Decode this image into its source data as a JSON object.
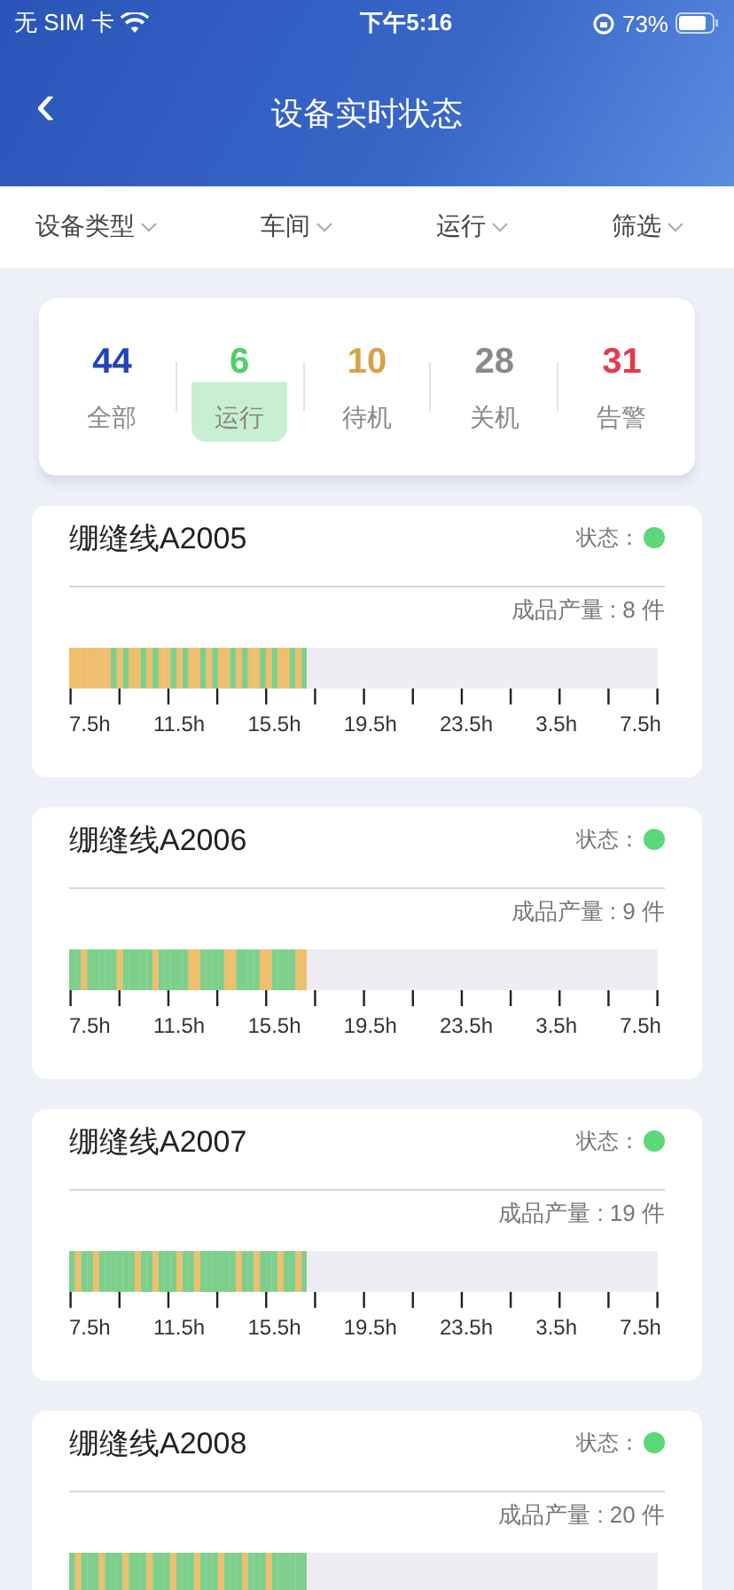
{
  "status_bar": {
    "carrier": "无 SIM 卡",
    "time": "下午5:16",
    "battery": "73%"
  },
  "header": {
    "back": "‹",
    "title": "设备实时状态"
  },
  "filters": [
    {
      "label": "设备类型"
    },
    {
      "label": "车间"
    },
    {
      "label": "运行"
    },
    {
      "label": "筛选"
    }
  ],
  "summary": [
    {
      "count": "44",
      "label": "全部",
      "color": "#2443b5",
      "selected": false
    },
    {
      "count": "6",
      "label": "运行",
      "color": "#4fcf6e",
      "selected": true
    },
    {
      "count": "10",
      "label": "待机",
      "color": "#d9a24a",
      "selected": false
    },
    {
      "count": "28",
      "label": "关机",
      "color": "#8a8a8a",
      "selected": false
    },
    {
      "count": "31",
      "label": "告警",
      "color": "#e8384f",
      "selected": false
    }
  ],
  "devices": [
    {
      "name": "绷缝线A2005",
      "status_label": "状态：",
      "color": "#5dd879",
      "output": "成品产量 : 8 件",
      "level": 0.405,
      "axis_labels": [
        "7.5h",
        "11.5h",
        "15.5h",
        "19.5h",
        "23.5h",
        "3.5h",
        "7.5h"
      ]
    },
    {
      "name": "绷缝线A2006",
      "status_label": "状态：",
      "color": "#5dd879",
      "output": "成品产量 : 9 件",
      "level": 0.405,
      "axis_labels": [
        "7.5h",
        "11.5h",
        "15.5h",
        "19.5h",
        "23.5h",
        "3.5h",
        "7.5h"
      ]
    },
    {
      "name": "绷缝线A2007",
      "status_label": "状态：",
      "color": "#5dd879",
      "output": "成品产量 : 19 件",
      "level": 0.405,
      "axis_labels": [
        "7.5h",
        "11.5h",
        "15.5h",
        "19.5h",
        "23.5h",
        "3.5h",
        "7.5h"
      ]
    },
    {
      "name": "绷缝线A2008",
      "status_label": "状态：",
      "color": "#5dd879",
      "output": "成品产量 : 20 件",
      "level": 0.405
    }
  ]
}
